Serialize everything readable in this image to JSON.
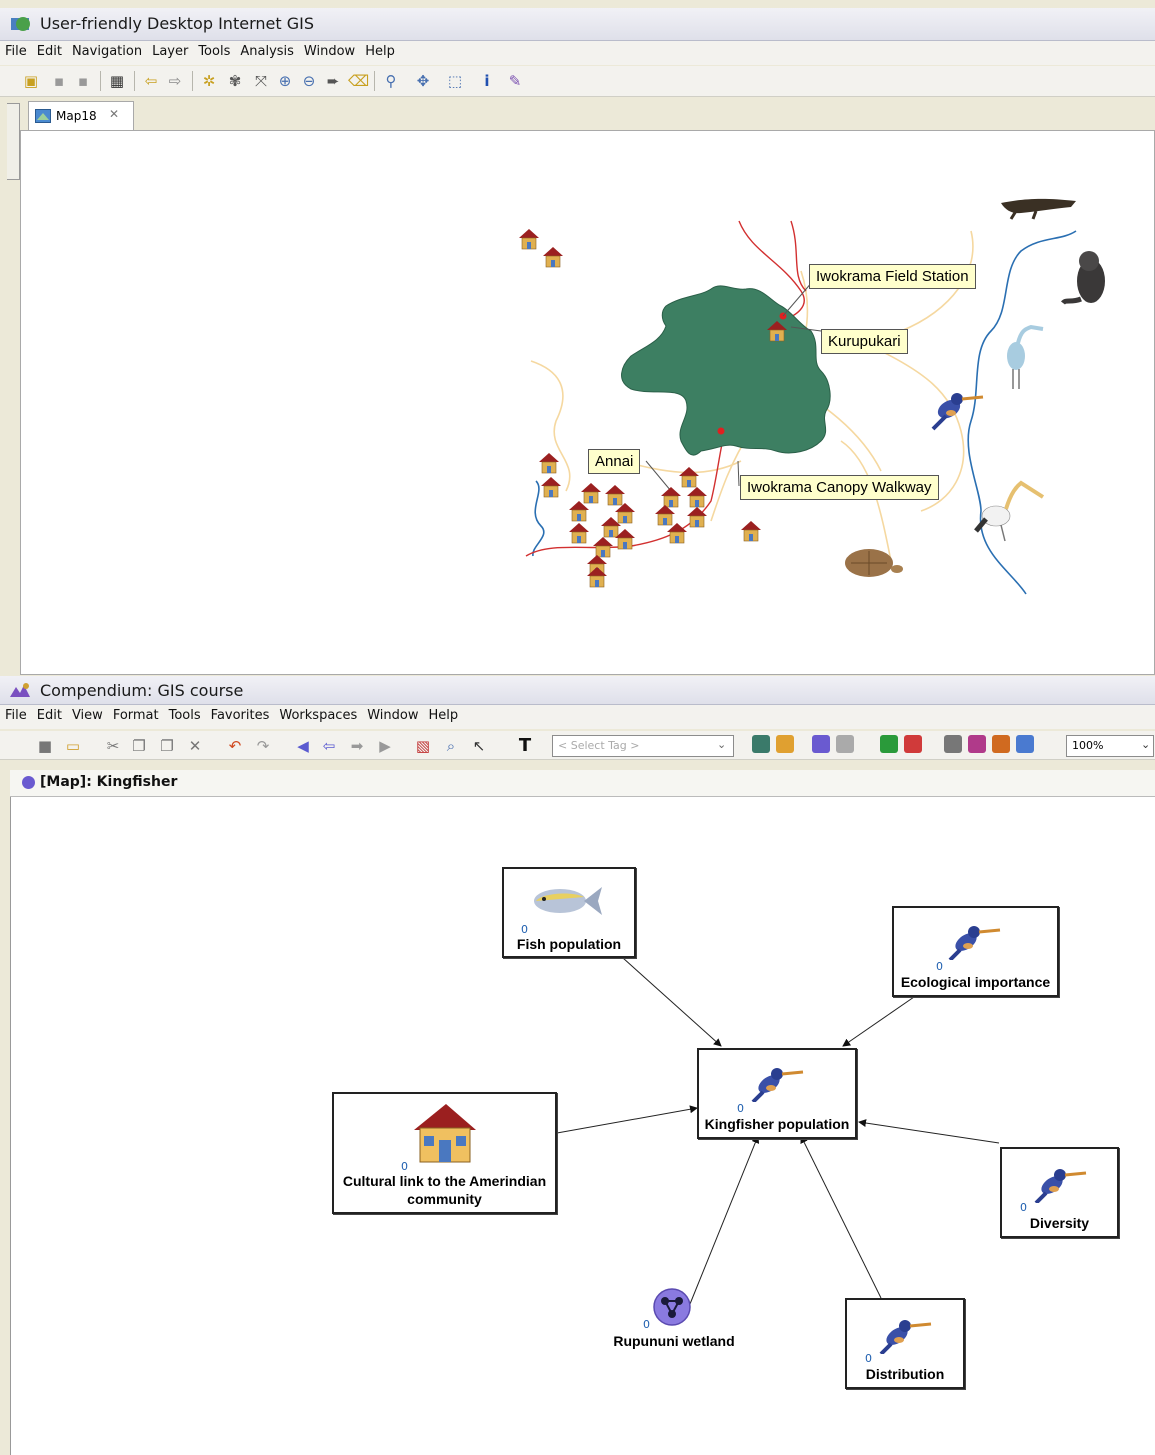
{
  "gis": {
    "title": "User-friendly Desktop Internet GIS",
    "menu": [
      "File",
      "Edit",
      "Navigation",
      "Layer",
      "Tools",
      "Analysis",
      "Window",
      "Help"
    ],
    "tab_label": "Map18",
    "tab_close": "✕",
    "labels": {
      "field_station": "Iwokrama Field Station",
      "kurupukari": "Kurupukari",
      "annai": "Annai",
      "canopy": "Iwokrama Canopy Walkway"
    }
  },
  "compendium": {
    "title": "Compendium: GIS course",
    "menu": [
      "File",
      "Edit",
      "View",
      "Format",
      "Tools",
      "Favorites",
      "Workspaces",
      "Window",
      "Help"
    ],
    "select_tag": "< Select Tag >",
    "zoom": "100%",
    "map_title": "[Map]: Kingfisher",
    "nodes": {
      "fish": {
        "label": "Fish population",
        "count": "0"
      },
      "ecological": {
        "label": "Ecological importance",
        "count": "0"
      },
      "kingfisher": {
        "label": "Kingfisher population",
        "count": "0"
      },
      "cultural": {
        "label1": "Cultural link to the Amerindian",
        "label2": "community",
        "count": "0"
      },
      "diversity": {
        "label": "Diversity",
        "count": "0"
      },
      "wetland": {
        "label": "Rupununi wetland",
        "count": "0"
      },
      "distribution": {
        "label": "Distribution",
        "count": "0"
      }
    }
  }
}
